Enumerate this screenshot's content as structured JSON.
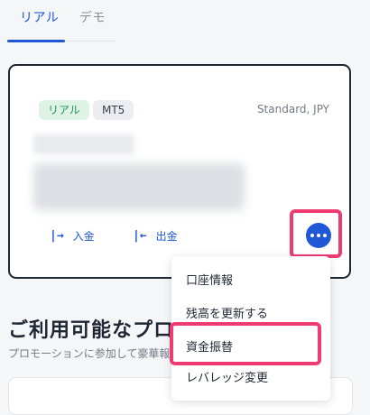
{
  "tabs": {
    "real": "リアル",
    "demo": "デモ"
  },
  "account": {
    "badge_real": "リアル",
    "badge_platform": "MT5",
    "type": "Standard, JPY",
    "deposit_label": "入金",
    "withdraw_label": "出金",
    "deposit_glyph": "|→",
    "withdraw_glyph": "|←"
  },
  "menu": {
    "items": [
      "口座情報",
      "残高を更新する",
      "資金振替",
      "レバレッジ変更"
    ]
  },
  "promo": {
    "title": "ご利用可能なプロモーション",
    "subtitle": "プロモーションに参加して豪華報酬を獲得しましょう"
  },
  "colors": {
    "accent": "#1f57d6",
    "highlight": "#ee3c73",
    "badge_green": "#24915a"
  }
}
